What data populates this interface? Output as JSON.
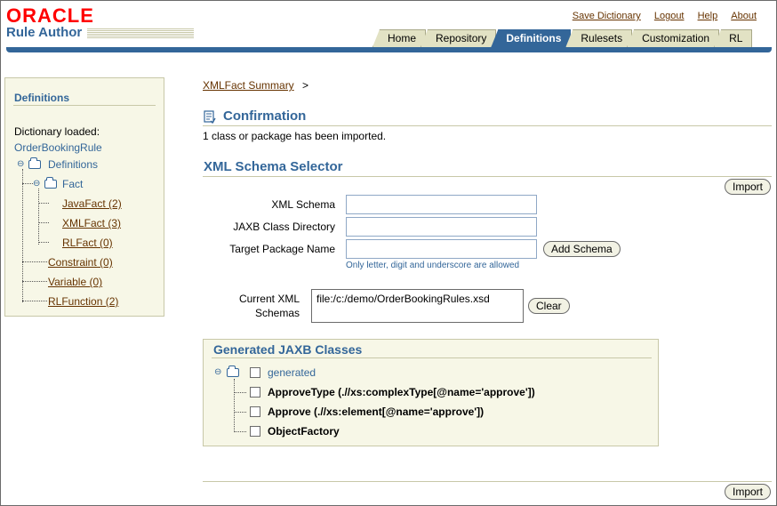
{
  "header": {
    "logo": "ORACLE",
    "app_name": "Rule Author",
    "global_links": [
      "Save Dictionary",
      "Logout",
      "Help",
      "About"
    ],
    "tabs": [
      {
        "label": "Home",
        "active": false
      },
      {
        "label": "Repository",
        "active": false
      },
      {
        "label": "Definitions",
        "active": true
      },
      {
        "label": "Rulesets",
        "active": false
      },
      {
        "label": "Customization",
        "active": false
      },
      {
        "label": "RL",
        "active": false
      }
    ],
    "accent_color": "#336699",
    "brand_color": "#ff0000"
  },
  "sidebar": {
    "title": "Definitions",
    "dictionary_label": "Dictionary loaded:",
    "dictionary_name": "OrderBookingRule",
    "tree": {
      "root": "Definitions",
      "fact": "Fact",
      "javafact": "JavaFact (2)",
      "xmlfact": "XMLFact (3)",
      "rlfact": "RLFact (0)",
      "constraint": "Constraint (0)",
      "variable": "Variable (0)",
      "rlfunction": "RLFunction (2)"
    }
  },
  "breadcrumb": {
    "link": "XMLFact Summary",
    "separator": ">"
  },
  "confirmation": {
    "title": "Confirmation",
    "message": "1 class or package has been imported."
  },
  "schema_selector": {
    "title": "XML Schema Selector",
    "import_label": "Import",
    "xml_schema_label": "XML Schema",
    "xml_schema_value": "",
    "jaxb_dir_label": "JAXB Class Directory",
    "jaxb_dir_value": "",
    "target_pkg_label": "Target Package Name",
    "target_pkg_value": "",
    "add_schema_label": "Add Schema",
    "hint": "Only letter, digit and underscore are allowed",
    "current_label_1": "Current XML",
    "current_label_2": "Schemas",
    "current_value": "file:/c:/demo/OrderBookingRules.xsd",
    "clear_label": "Clear"
  },
  "jaxb": {
    "title": "Generated JAXB Classes",
    "items": [
      {
        "label": "generated",
        "checked": false
      },
      {
        "label": "ApproveType (.//xs:complexType[@name='approve'])",
        "checked": false
      },
      {
        "label": "Approve (.//xs:element[@name='approve'])",
        "checked": false
      },
      {
        "label": "ObjectFactory",
        "checked": false
      }
    ]
  },
  "footer": {
    "import_label": "Import"
  }
}
